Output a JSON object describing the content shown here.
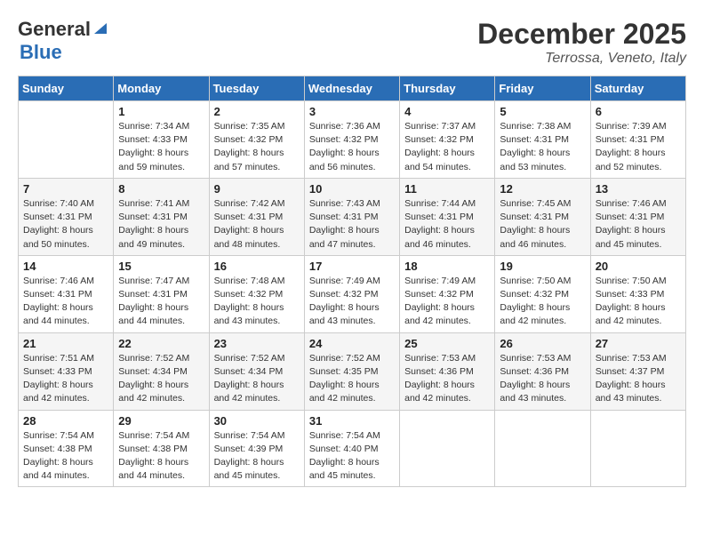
{
  "header": {
    "logo_line1": "General",
    "logo_line2": "Blue",
    "month": "December 2025",
    "location": "Terrossa, Veneto, Italy"
  },
  "days_of_week": [
    "Sunday",
    "Monday",
    "Tuesday",
    "Wednesday",
    "Thursday",
    "Friday",
    "Saturday"
  ],
  "weeks": [
    [
      {
        "num": "",
        "info": ""
      },
      {
        "num": "1",
        "info": "Sunrise: 7:34 AM\nSunset: 4:33 PM\nDaylight: 8 hours\nand 59 minutes."
      },
      {
        "num": "2",
        "info": "Sunrise: 7:35 AM\nSunset: 4:32 PM\nDaylight: 8 hours\nand 57 minutes."
      },
      {
        "num": "3",
        "info": "Sunrise: 7:36 AM\nSunset: 4:32 PM\nDaylight: 8 hours\nand 56 minutes."
      },
      {
        "num": "4",
        "info": "Sunrise: 7:37 AM\nSunset: 4:32 PM\nDaylight: 8 hours\nand 54 minutes."
      },
      {
        "num": "5",
        "info": "Sunrise: 7:38 AM\nSunset: 4:31 PM\nDaylight: 8 hours\nand 53 minutes."
      },
      {
        "num": "6",
        "info": "Sunrise: 7:39 AM\nSunset: 4:31 PM\nDaylight: 8 hours\nand 52 minutes."
      }
    ],
    [
      {
        "num": "7",
        "info": "Sunrise: 7:40 AM\nSunset: 4:31 PM\nDaylight: 8 hours\nand 50 minutes."
      },
      {
        "num": "8",
        "info": "Sunrise: 7:41 AM\nSunset: 4:31 PM\nDaylight: 8 hours\nand 49 minutes."
      },
      {
        "num": "9",
        "info": "Sunrise: 7:42 AM\nSunset: 4:31 PM\nDaylight: 8 hours\nand 48 minutes."
      },
      {
        "num": "10",
        "info": "Sunrise: 7:43 AM\nSunset: 4:31 PM\nDaylight: 8 hours\nand 47 minutes."
      },
      {
        "num": "11",
        "info": "Sunrise: 7:44 AM\nSunset: 4:31 PM\nDaylight: 8 hours\nand 46 minutes."
      },
      {
        "num": "12",
        "info": "Sunrise: 7:45 AM\nSunset: 4:31 PM\nDaylight: 8 hours\nand 46 minutes."
      },
      {
        "num": "13",
        "info": "Sunrise: 7:46 AM\nSunset: 4:31 PM\nDaylight: 8 hours\nand 45 minutes."
      }
    ],
    [
      {
        "num": "14",
        "info": "Sunrise: 7:46 AM\nSunset: 4:31 PM\nDaylight: 8 hours\nand 44 minutes."
      },
      {
        "num": "15",
        "info": "Sunrise: 7:47 AM\nSunset: 4:31 PM\nDaylight: 8 hours\nand 44 minutes."
      },
      {
        "num": "16",
        "info": "Sunrise: 7:48 AM\nSunset: 4:32 PM\nDaylight: 8 hours\nand 43 minutes."
      },
      {
        "num": "17",
        "info": "Sunrise: 7:49 AM\nSunset: 4:32 PM\nDaylight: 8 hours\nand 43 minutes."
      },
      {
        "num": "18",
        "info": "Sunrise: 7:49 AM\nSunset: 4:32 PM\nDaylight: 8 hours\nand 42 minutes."
      },
      {
        "num": "19",
        "info": "Sunrise: 7:50 AM\nSunset: 4:32 PM\nDaylight: 8 hours\nand 42 minutes."
      },
      {
        "num": "20",
        "info": "Sunrise: 7:50 AM\nSunset: 4:33 PM\nDaylight: 8 hours\nand 42 minutes."
      }
    ],
    [
      {
        "num": "21",
        "info": "Sunrise: 7:51 AM\nSunset: 4:33 PM\nDaylight: 8 hours\nand 42 minutes."
      },
      {
        "num": "22",
        "info": "Sunrise: 7:52 AM\nSunset: 4:34 PM\nDaylight: 8 hours\nand 42 minutes."
      },
      {
        "num": "23",
        "info": "Sunrise: 7:52 AM\nSunset: 4:34 PM\nDaylight: 8 hours\nand 42 minutes."
      },
      {
        "num": "24",
        "info": "Sunrise: 7:52 AM\nSunset: 4:35 PM\nDaylight: 8 hours\nand 42 minutes."
      },
      {
        "num": "25",
        "info": "Sunrise: 7:53 AM\nSunset: 4:36 PM\nDaylight: 8 hours\nand 42 minutes."
      },
      {
        "num": "26",
        "info": "Sunrise: 7:53 AM\nSunset: 4:36 PM\nDaylight: 8 hours\nand 43 minutes."
      },
      {
        "num": "27",
        "info": "Sunrise: 7:53 AM\nSunset: 4:37 PM\nDaylight: 8 hours\nand 43 minutes."
      }
    ],
    [
      {
        "num": "28",
        "info": "Sunrise: 7:54 AM\nSunset: 4:38 PM\nDaylight: 8 hours\nand 44 minutes."
      },
      {
        "num": "29",
        "info": "Sunrise: 7:54 AM\nSunset: 4:38 PM\nDaylight: 8 hours\nand 44 minutes."
      },
      {
        "num": "30",
        "info": "Sunrise: 7:54 AM\nSunset: 4:39 PM\nDaylight: 8 hours\nand 45 minutes."
      },
      {
        "num": "31",
        "info": "Sunrise: 7:54 AM\nSunset: 4:40 PM\nDaylight: 8 hours\nand 45 minutes."
      },
      {
        "num": "",
        "info": ""
      },
      {
        "num": "",
        "info": ""
      },
      {
        "num": "",
        "info": ""
      }
    ]
  ]
}
